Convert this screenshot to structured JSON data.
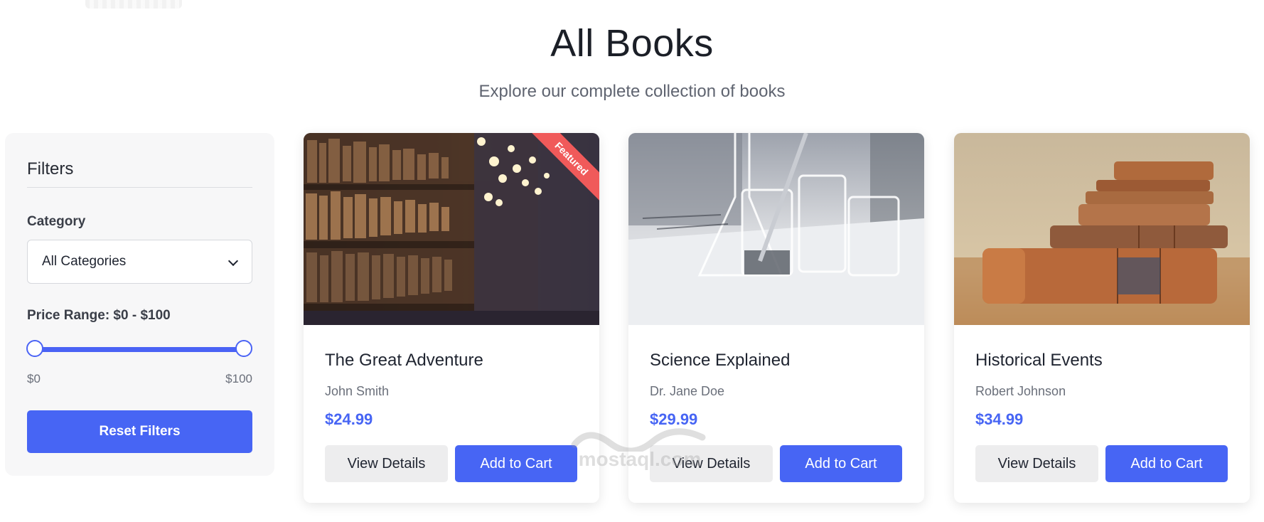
{
  "header": {
    "title": "All Books",
    "subtitle": "Explore our complete collection of books"
  },
  "filters": {
    "title": "Filters",
    "category_label": "Category",
    "category_selected": "All Categories",
    "price_label": "Price Range: $0 - $100",
    "price_min_label": "$0",
    "price_max_label": "$100",
    "price_range": {
      "min": 0,
      "max": 100,
      "selected_min": 0,
      "selected_max": 100
    },
    "reset_label": "Reset Filters"
  },
  "books": [
    {
      "title": "The Great Adventure",
      "author": "John Smith",
      "price": "$24.99",
      "badge": "Featured",
      "image": "library-bookshelves",
      "details_label": "View Details",
      "cart_label": "Add to Cart"
    },
    {
      "title": "Science Explained",
      "author": "Dr. Jane Doe",
      "price": "$29.99",
      "image": "lab-glassware",
      "details_label": "View Details",
      "cart_label": "Add to Cart"
    },
    {
      "title": "Historical Events",
      "author": "Robert Johnson",
      "price": "$34.99",
      "image": "stack-of-old-books",
      "details_label": "View Details",
      "cart_label": "Add to Cart"
    }
  ],
  "watermark": {
    "text": "mostaql.com"
  },
  "colors": {
    "accent": "#4765f4",
    "ribbon": "#f05a5a",
    "sidebar_bg": "#f7f7f8"
  }
}
